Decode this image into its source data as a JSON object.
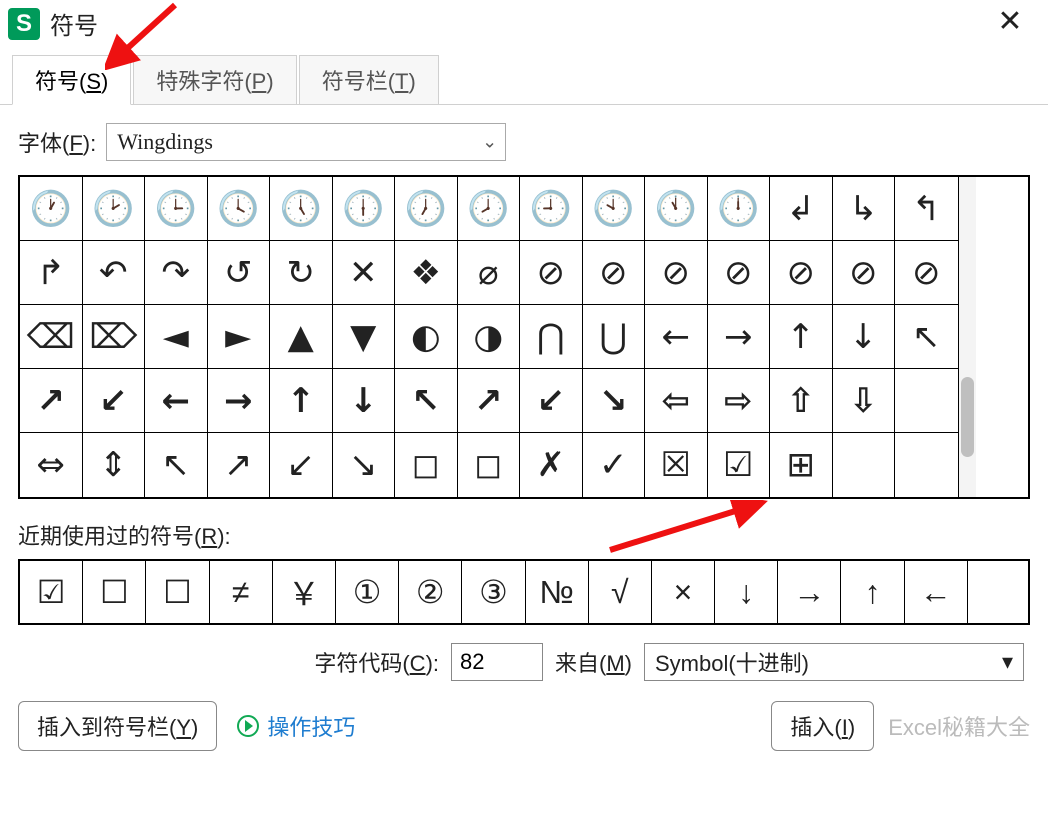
{
  "window": {
    "app_glyph": "S",
    "title": "符号",
    "close": "✕"
  },
  "tabs": [
    {
      "label": "符号(",
      "hotkey": "S",
      "tail": ")"
    },
    {
      "label": "特殊字符(",
      "hotkey": "P",
      "tail": ")"
    },
    {
      "label": "符号栏(",
      "hotkey": "T",
      "tail": ")"
    }
  ],
  "font_row": {
    "label_pre": "字体(",
    "hotkey": "F",
    "label_post": "):",
    "value": "Wingdings"
  },
  "symbol_grid": {
    "cols": 15,
    "rows": 5,
    "cells": [
      "🕐",
      "🕑",
      "🕒",
      "🕓",
      "🕔",
      "🕕",
      "🕖",
      "🕗",
      "🕘",
      "🕙",
      "🕚",
      "🕛",
      "↲",
      "↳",
      "↰",
      "↱",
      "↶",
      "↷",
      "↺",
      "↻",
      "✕",
      "❖",
      "⌀",
      "⊘",
      "⊘",
      "⊘",
      "⊘",
      "⊘",
      "⊘",
      "⊘",
      "⌫",
      "⌦",
      "◄",
      "►",
      "▲",
      "▼",
      "◐",
      "◑",
      "⋂",
      "⋃",
      "←",
      "→",
      "↑",
      "↓",
      "↖",
      "↗",
      "↙",
      "←",
      "→",
      "↑",
      "↓",
      "↖",
      "↗",
      "↙",
      "↘",
      "⇦",
      "⇨",
      "⇧",
      "⇩",
      "",
      "⇔",
      "⇕",
      "↖",
      "↗",
      "↙",
      "↘",
      "◻",
      "◻",
      "✗",
      "✓",
      "☒",
      "☑",
      "⊞",
      "",
      ""
    ],
    "bold_rows": [
      3
    ]
  },
  "recent": {
    "label_pre": "近期使用过的符号(",
    "hotkey": "R",
    "label_post": "):",
    "cells": [
      "☑",
      "☐",
      "☐",
      "≠",
      "￥",
      "①",
      "②",
      "③",
      "№",
      "√",
      "×",
      "↓",
      "→",
      "↑",
      "←",
      ""
    ]
  },
  "code_row": {
    "code_label_pre": "字符代码(",
    "code_hotkey": "C",
    "code_label_post": "):",
    "code_value": "82",
    "from_label_pre": "来自(",
    "from_hotkey": "M",
    "from_label_post": ")",
    "from_value": "Symbol(十进制)"
  },
  "footer": {
    "insert_bar_pre": "插入到符号栏(",
    "insert_bar_hotkey": "Y",
    "insert_bar_post": ")",
    "tips": "操作技巧",
    "insert_pre": "插入(",
    "insert_hotkey": "I",
    "insert_post": ")",
    "watermark": "Excel秘籍大全"
  }
}
